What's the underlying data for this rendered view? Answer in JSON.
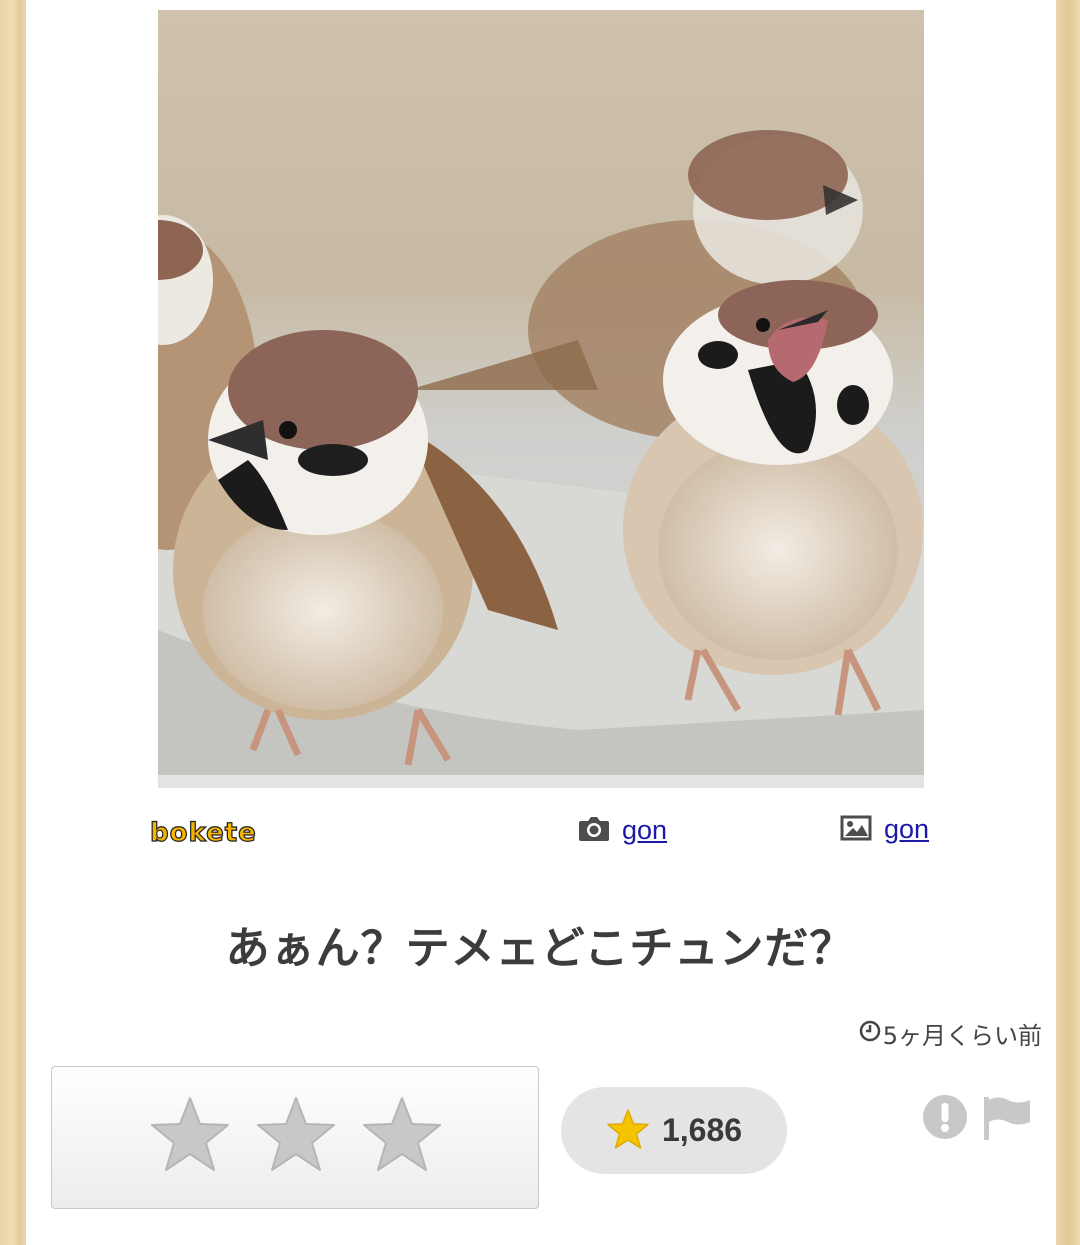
{
  "post": {
    "photo_alt": "sparrows photo",
    "logo_text": "bokete",
    "photo_credit_user": "gon",
    "image_credit_user": "gon",
    "caption": "あぁん？テメェどこチュンだ？",
    "time_ago": "5ヶ月くらい前",
    "rating_stars_count": 3,
    "score": "1,686"
  },
  "colors": {
    "link": "#1a1aa6",
    "score_star": "#f5c400",
    "rate_star": "#c8c8c8",
    "caption_text": "#3c3c3c"
  },
  "icons": {
    "photo_credit": "camera-icon",
    "image_credit": "image-icon",
    "time": "clock-icon",
    "score": "star-icon",
    "report": "exclamation-icon",
    "flag": "flag-icon"
  }
}
